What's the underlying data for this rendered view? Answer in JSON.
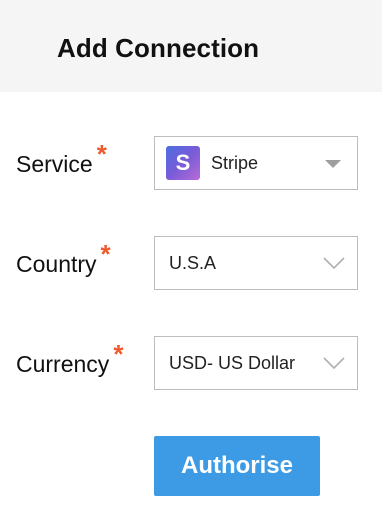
{
  "header": {
    "title": "Add Connection"
  },
  "fields": [
    {
      "label": "Service",
      "required_mark": "*",
      "value": "Stripe",
      "logo_letter": "S",
      "icon": "stripe-logo-icon"
    },
    {
      "label": "Country",
      "required_mark": "*",
      "value": "U.S.A",
      "icon": "chevron-down-icon"
    },
    {
      "label": "Currency",
      "required_mark": "*",
      "value": "USD- US Dollar",
      "icon": "chevron-down-icon"
    }
  ],
  "actions": {
    "authorise_label": "Authorise"
  },
  "colors": {
    "required": "#f0592b",
    "primary_button": "#3d9be5",
    "header_bg": "#f5f5f5"
  }
}
